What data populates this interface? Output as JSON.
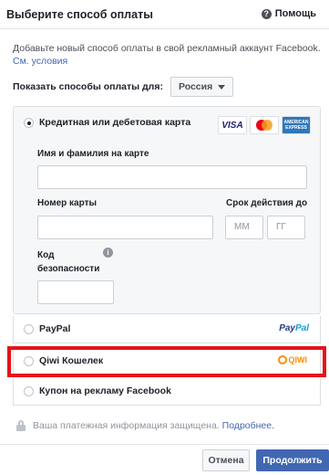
{
  "header": {
    "title": "Выберите способ оплаты",
    "help_label": "Помощь"
  },
  "intro": {
    "text": "Добавьте новый способ оплаты в свой рекламный аккаунт Facebook.",
    "terms_link": "См. условия"
  },
  "country": {
    "label": "Показать способы оплаты для:",
    "selected": "Россия"
  },
  "card_option": {
    "label": "Кредитная или дебетовая карта",
    "selected": true,
    "logos": [
      "VISA",
      "MasterCard",
      "AMERICAN EXPRESS"
    ],
    "name_label": "Имя и фамилия на карте",
    "number_label": "Номер карты",
    "expiry_label": "Срок действия до",
    "expiry_month_placeholder": "ММ",
    "expiry_year_placeholder": "ГГ",
    "cvv_label": "Код безопасности"
  },
  "other_options": [
    {
      "label": "PayPal",
      "logo": "PayPal"
    },
    {
      "label": "Qiwi Кошелек",
      "logo": "QIWI"
    },
    {
      "label": "Купон на рекламу Facebook"
    }
  ],
  "secure": {
    "text": "Ваша платежная информация защищена.",
    "link": "Подробнее."
  },
  "buttons": {
    "cancel": "Отмена",
    "continue": "Продолжить"
  },
  "colors": {
    "accent": "#4267b2",
    "highlight": "#e5131a"
  }
}
